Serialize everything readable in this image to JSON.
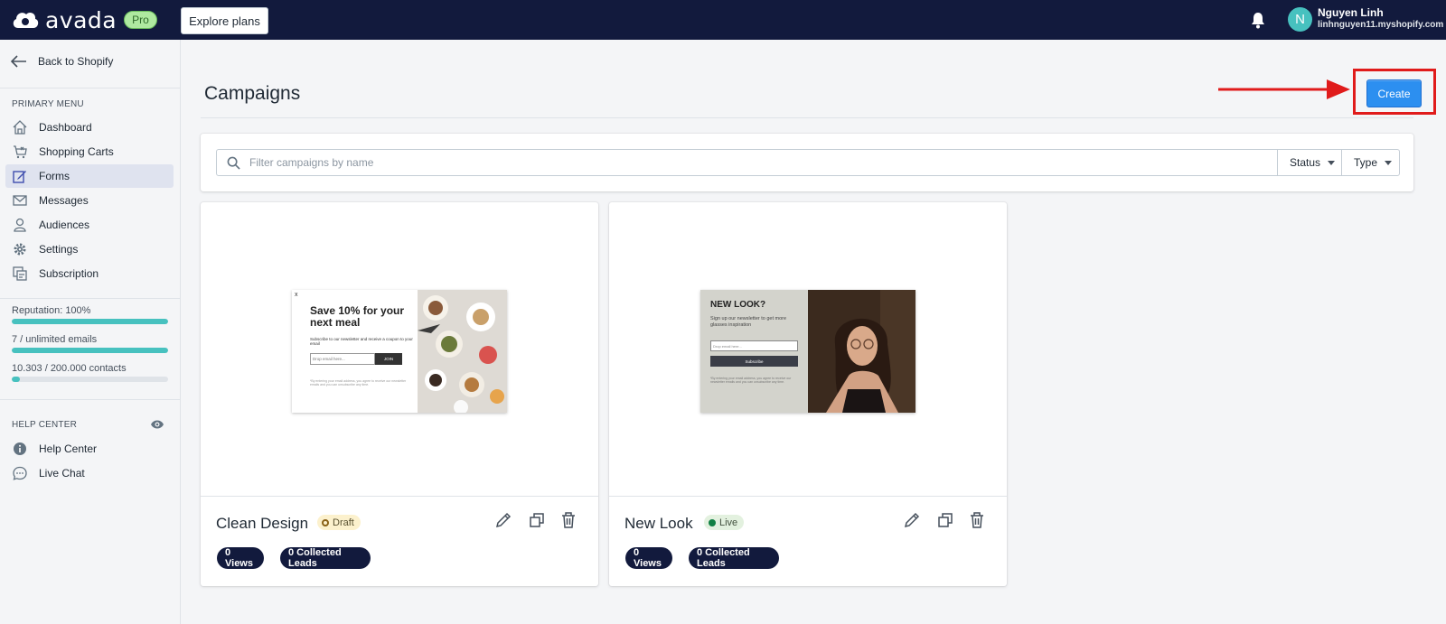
{
  "topbar": {
    "brand": "avada",
    "plan_badge": "Pro",
    "explore_label": "Explore plans",
    "user": {
      "initial": "N",
      "name": "Nguyen Linh",
      "shop": "linhnguyen11.myshopify.com"
    }
  },
  "sidebar": {
    "back_label": "Back to Shopify",
    "primary_title": "PRIMARY MENU",
    "items": [
      {
        "label": "Dashboard",
        "icon": "home-icon"
      },
      {
        "label": "Shopping Carts",
        "icon": "cart-icon"
      },
      {
        "label": "Forms",
        "icon": "forms-icon",
        "active": true
      },
      {
        "label": "Messages",
        "icon": "mail-icon"
      },
      {
        "label": "Audiences",
        "icon": "person-icon"
      },
      {
        "label": "Settings",
        "icon": "gear-icon"
      },
      {
        "label": "Subscription",
        "icon": "subscription-icon"
      }
    ],
    "meters": [
      {
        "label": "Reputation: 100%",
        "fraction": 1.0
      },
      {
        "label": "7 / unlimited emails",
        "fraction": 1.0
      },
      {
        "label": "10.303 / 200.000 contacts",
        "fraction": 0.052
      }
    ],
    "help_title": "HELP CENTER",
    "help_items": [
      {
        "label": "Help Center",
        "icon": "info-icon"
      },
      {
        "label": "Live Chat",
        "icon": "chat-icon"
      }
    ]
  },
  "main": {
    "title": "Campaigns",
    "create_label": "Create",
    "search_placeholder": "Filter campaigns by name",
    "filters": {
      "status": "Status",
      "type": "Type"
    },
    "campaigns": [
      {
        "name": "Clean Design",
        "status": "Draft",
        "views": "0 Views",
        "leads": "0 Collected Leads",
        "preview": {
          "close": "x",
          "headline": "Save 10% for your next meal",
          "subtext": "Subscribe to our newsletter and receive a coupon to your email",
          "field_placeholder": "Drop email here...",
          "button": "JOIN",
          "fine_print": "*By entering your email address, you agree to receive our newsletter emails and you can unsubscribe any time."
        }
      },
      {
        "name": "New Look",
        "status": "Live",
        "views": "0 Views",
        "leads": "0 Collected Leads",
        "preview": {
          "headline": "NEW LOOK?",
          "subtext": "Sign up our newsletter to get more glasses inspiration",
          "field_placeholder": "Drop email here...",
          "button": "Subscribe",
          "fine_print": "*By entering your email address, you agree to receive our newsletter emails and you can unsubscribe any time."
        }
      }
    ]
  },
  "colors": {
    "topbar": "#121a3d",
    "accent": "#2c8ff0",
    "meter": "#47c1bf",
    "highlight": "#e01b1b"
  }
}
